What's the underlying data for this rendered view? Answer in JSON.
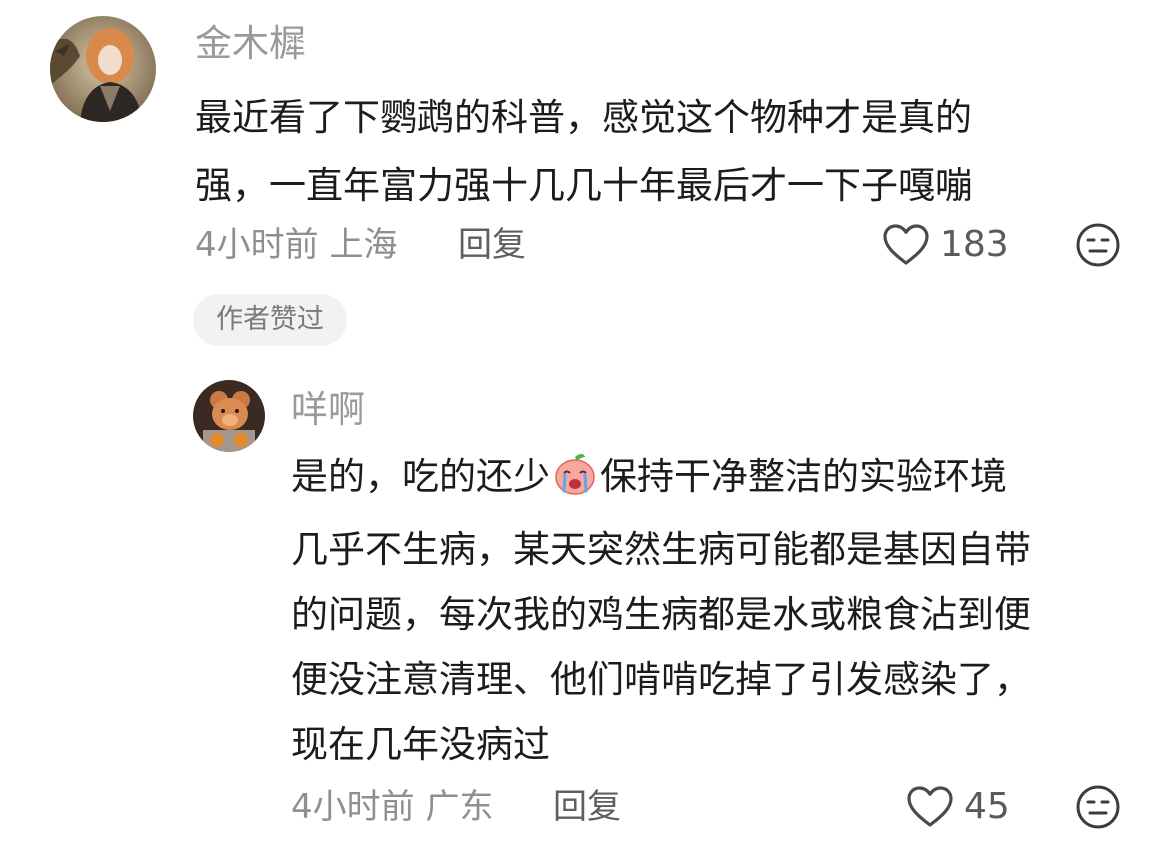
{
  "comments": [
    {
      "username": "金木樨",
      "lines": [
        "最近看了下鹦鹉的科普，感觉这个物种才是真的",
        "强，一直年富力强十几几十年最后才一下子嘎嘣"
      ],
      "time_location": "4小时前 上海",
      "reply_label": "回复",
      "likes": "183",
      "badge": "作者赞过"
    },
    {
      "username": "咩啊",
      "line1_before": "是的，吃的还少",
      "emoji": "crying-peach-emoji",
      "line1_after": "保持干净整洁的实验环境",
      "lines": [
        "几乎不生病，某天突然生病可能都是基因自带",
        "的问题，每次我的鸡生病都是水或粮食沾到便",
        "便没注意清理、他们啃啃吃掉了引发感染了，",
        "现在几年没病过"
      ],
      "time_location": "4小时前 广东",
      "reply_label": "回复",
      "likes": "45"
    }
  ],
  "icons": {
    "like": "heart-outline-icon",
    "dislike": "neutral-face-icon"
  },
  "colors": {
    "username": "#9a9a9a",
    "body": "#1c1c1c",
    "meta": "#8f8f8f",
    "badge_bg": "#f2f2f2"
  }
}
